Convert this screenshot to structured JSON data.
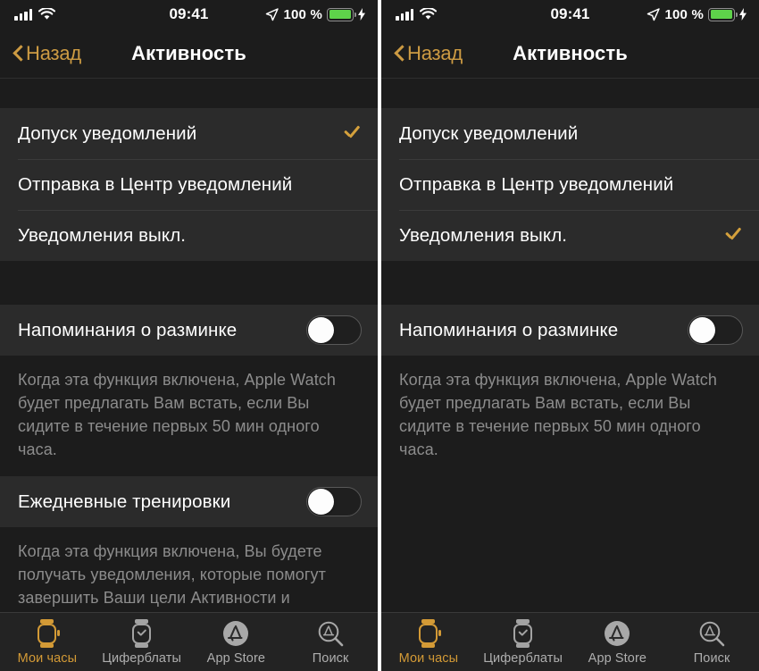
{
  "status_bar": {
    "time": "09:41",
    "battery_percent": "100 %",
    "signal_icon": "cellular-bars-icon",
    "wifi_icon": "wifi-icon",
    "location_icon": "location-arrow-icon",
    "battery_icon": "battery-full-icon",
    "charging_icon": "lightning-bolt-icon",
    "battery_color": "#5ed24a"
  },
  "nav": {
    "back_label": "Назад",
    "title": "Активность",
    "accent_color": "#cd9b43"
  },
  "notification_options": [
    {
      "label": "Допуск уведомлений"
    },
    {
      "label": "Отправка в Центр уведомлений"
    },
    {
      "label": "Уведомления выкл."
    }
  ],
  "left_panel": {
    "selected_option_index": 0,
    "toggles": [
      {
        "label": "Напоминания о разминке",
        "state": "off",
        "note": "Когда эта функция включена, Apple Watch\nбудет предлагать Вам встать, если Вы\nсидите в течение первых 50 мин одного\nчаса."
      },
      {
        "label": "Ежедневные тренировки",
        "state": "off",
        "note": "Когда эта функция включена, Вы будете\nполучать уведомления, которые помогут\nзавершить Ваши цели Активности и\nЕжемесячные вызовы."
      }
    ]
  },
  "right_panel": {
    "selected_option_index": 2,
    "toggles": [
      {
        "label": "Напоминания о разминке",
        "state": "off",
        "note": "Когда эта функция включена, Apple Watch\nбудет предлагать Вам встать, если Вы\nсидите в течение первых 50 мин одного\nчаса."
      }
    ]
  },
  "tab_bar": {
    "items": [
      {
        "label": "Мои часы",
        "icon": "watch-icon",
        "active": true
      },
      {
        "label": "Циферблаты",
        "icon": "watch-face-icon",
        "active": false
      },
      {
        "label": "App Store",
        "icon": "app-store-icon",
        "active": false
      },
      {
        "label": "Поиск",
        "icon": "search-icon",
        "active": false
      }
    ],
    "active_color": "#d39a36",
    "inactive_color": "#aeaeae"
  },
  "colors": {
    "background": "#1c1c1c",
    "row_background": "#2b2b2b",
    "checkmark": "#d4a03c",
    "note_text": "#8c8c8c"
  }
}
